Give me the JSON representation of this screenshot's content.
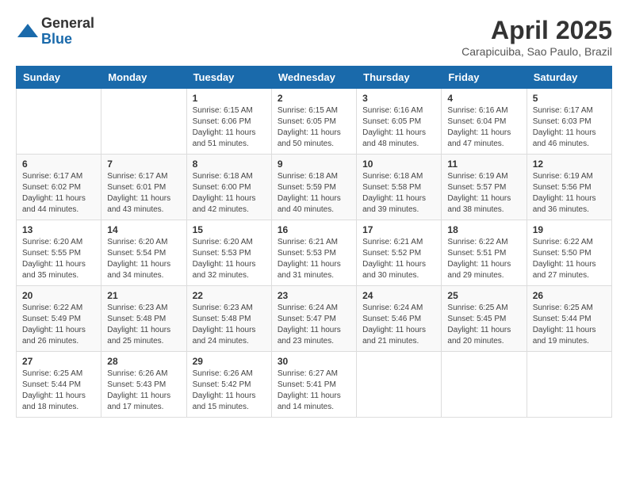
{
  "logo": {
    "general": "General",
    "blue": "Blue"
  },
  "title": {
    "month_year": "April 2025",
    "location": "Carapicuiba, Sao Paulo, Brazil"
  },
  "headers": [
    "Sunday",
    "Monday",
    "Tuesday",
    "Wednesday",
    "Thursday",
    "Friday",
    "Saturday"
  ],
  "weeks": [
    [
      {
        "day": "",
        "info": ""
      },
      {
        "day": "",
        "info": ""
      },
      {
        "day": "1",
        "info": "Sunrise: 6:15 AM\nSunset: 6:06 PM\nDaylight: 11 hours and 51 minutes."
      },
      {
        "day": "2",
        "info": "Sunrise: 6:15 AM\nSunset: 6:05 PM\nDaylight: 11 hours and 50 minutes."
      },
      {
        "day": "3",
        "info": "Sunrise: 6:16 AM\nSunset: 6:05 PM\nDaylight: 11 hours and 48 minutes."
      },
      {
        "day": "4",
        "info": "Sunrise: 6:16 AM\nSunset: 6:04 PM\nDaylight: 11 hours and 47 minutes."
      },
      {
        "day": "5",
        "info": "Sunrise: 6:17 AM\nSunset: 6:03 PM\nDaylight: 11 hours and 46 minutes."
      }
    ],
    [
      {
        "day": "6",
        "info": "Sunrise: 6:17 AM\nSunset: 6:02 PM\nDaylight: 11 hours and 44 minutes."
      },
      {
        "day": "7",
        "info": "Sunrise: 6:17 AM\nSunset: 6:01 PM\nDaylight: 11 hours and 43 minutes."
      },
      {
        "day": "8",
        "info": "Sunrise: 6:18 AM\nSunset: 6:00 PM\nDaylight: 11 hours and 42 minutes."
      },
      {
        "day": "9",
        "info": "Sunrise: 6:18 AM\nSunset: 5:59 PM\nDaylight: 11 hours and 40 minutes."
      },
      {
        "day": "10",
        "info": "Sunrise: 6:18 AM\nSunset: 5:58 PM\nDaylight: 11 hours and 39 minutes."
      },
      {
        "day": "11",
        "info": "Sunrise: 6:19 AM\nSunset: 5:57 PM\nDaylight: 11 hours and 38 minutes."
      },
      {
        "day": "12",
        "info": "Sunrise: 6:19 AM\nSunset: 5:56 PM\nDaylight: 11 hours and 36 minutes."
      }
    ],
    [
      {
        "day": "13",
        "info": "Sunrise: 6:20 AM\nSunset: 5:55 PM\nDaylight: 11 hours and 35 minutes."
      },
      {
        "day": "14",
        "info": "Sunrise: 6:20 AM\nSunset: 5:54 PM\nDaylight: 11 hours and 34 minutes."
      },
      {
        "day": "15",
        "info": "Sunrise: 6:20 AM\nSunset: 5:53 PM\nDaylight: 11 hours and 32 minutes."
      },
      {
        "day": "16",
        "info": "Sunrise: 6:21 AM\nSunset: 5:53 PM\nDaylight: 11 hours and 31 minutes."
      },
      {
        "day": "17",
        "info": "Sunrise: 6:21 AM\nSunset: 5:52 PM\nDaylight: 11 hours and 30 minutes."
      },
      {
        "day": "18",
        "info": "Sunrise: 6:22 AM\nSunset: 5:51 PM\nDaylight: 11 hours and 29 minutes."
      },
      {
        "day": "19",
        "info": "Sunrise: 6:22 AM\nSunset: 5:50 PM\nDaylight: 11 hours and 27 minutes."
      }
    ],
    [
      {
        "day": "20",
        "info": "Sunrise: 6:22 AM\nSunset: 5:49 PM\nDaylight: 11 hours and 26 minutes."
      },
      {
        "day": "21",
        "info": "Sunrise: 6:23 AM\nSunset: 5:48 PM\nDaylight: 11 hours and 25 minutes."
      },
      {
        "day": "22",
        "info": "Sunrise: 6:23 AM\nSunset: 5:48 PM\nDaylight: 11 hours and 24 minutes."
      },
      {
        "day": "23",
        "info": "Sunrise: 6:24 AM\nSunset: 5:47 PM\nDaylight: 11 hours and 23 minutes."
      },
      {
        "day": "24",
        "info": "Sunrise: 6:24 AM\nSunset: 5:46 PM\nDaylight: 11 hours and 21 minutes."
      },
      {
        "day": "25",
        "info": "Sunrise: 6:25 AM\nSunset: 5:45 PM\nDaylight: 11 hours and 20 minutes."
      },
      {
        "day": "26",
        "info": "Sunrise: 6:25 AM\nSunset: 5:44 PM\nDaylight: 11 hours and 19 minutes."
      }
    ],
    [
      {
        "day": "27",
        "info": "Sunrise: 6:25 AM\nSunset: 5:44 PM\nDaylight: 11 hours and 18 minutes."
      },
      {
        "day": "28",
        "info": "Sunrise: 6:26 AM\nSunset: 5:43 PM\nDaylight: 11 hours and 17 minutes."
      },
      {
        "day": "29",
        "info": "Sunrise: 6:26 AM\nSunset: 5:42 PM\nDaylight: 11 hours and 15 minutes."
      },
      {
        "day": "30",
        "info": "Sunrise: 6:27 AM\nSunset: 5:41 PM\nDaylight: 11 hours and 14 minutes."
      },
      {
        "day": "",
        "info": ""
      },
      {
        "day": "",
        "info": ""
      },
      {
        "day": "",
        "info": ""
      }
    ]
  ]
}
